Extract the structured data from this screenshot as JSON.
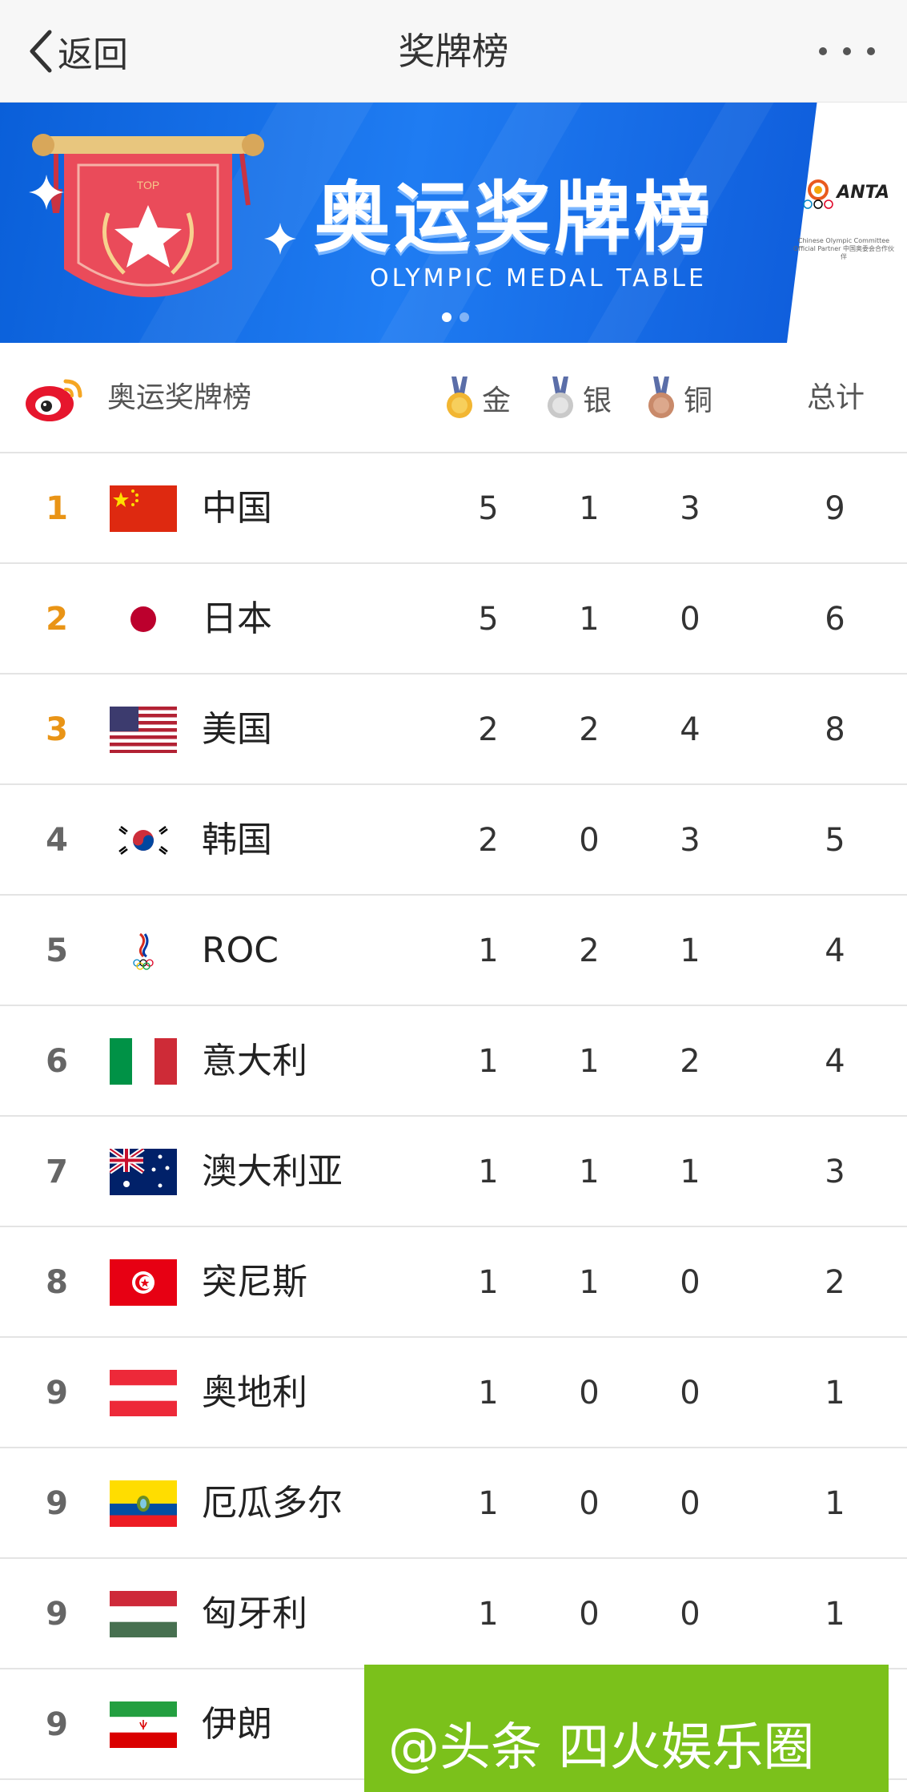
{
  "nav": {
    "back_label": "返回",
    "title": "奖牌榜"
  },
  "banner": {
    "title": "奥运奖牌榜",
    "subtitle": "OLYMPIC  MEDAL TABLE",
    "pennant_text": "TOP",
    "sponsor_brand": "ANTA",
    "sponsor_caption": "Chinese Olympic Committee Official Partner 中国奥委会合作伙伴"
  },
  "table": {
    "header": {
      "source": "奥运奖牌榜",
      "gold": "金",
      "silver": "银",
      "bronze": "铜",
      "total": "总计"
    },
    "rows": [
      {
        "rank": "1",
        "country": "中国",
        "flag": "china-flag",
        "gold": "5",
        "silver": "1",
        "bronze": "3",
        "total": "9"
      },
      {
        "rank": "2",
        "country": "日本",
        "flag": "japan-flag",
        "gold": "5",
        "silver": "1",
        "bronze": "0",
        "total": "6"
      },
      {
        "rank": "3",
        "country": "美国",
        "flag": "usa-flag",
        "gold": "2",
        "silver": "2",
        "bronze": "4",
        "total": "8"
      },
      {
        "rank": "4",
        "country": "韩国",
        "flag": "korea-flag",
        "gold": "2",
        "silver": "0",
        "bronze": "3",
        "total": "5"
      },
      {
        "rank": "5",
        "country": "ROC",
        "flag": "roc-emblem",
        "gold": "1",
        "silver": "2",
        "bronze": "1",
        "total": "4"
      },
      {
        "rank": "6",
        "country": "意大利",
        "flag": "italy-flag",
        "gold": "1",
        "silver": "1",
        "bronze": "2",
        "total": "4"
      },
      {
        "rank": "7",
        "country": "澳大利亚",
        "flag": "australia-flag",
        "gold": "1",
        "silver": "1",
        "bronze": "1",
        "total": "3"
      },
      {
        "rank": "8",
        "country": "突尼斯",
        "flag": "tunisia-flag",
        "gold": "1",
        "silver": "1",
        "bronze": "0",
        "total": "2"
      },
      {
        "rank": "9",
        "country": "奥地利",
        "flag": "austria-flag",
        "gold": "1",
        "silver": "0",
        "bronze": "0",
        "total": "1"
      },
      {
        "rank": "9",
        "country": "厄瓜多尔",
        "flag": "ecuador-flag",
        "gold": "1",
        "silver": "0",
        "bronze": "0",
        "total": "1"
      },
      {
        "rank": "9",
        "country": "匈牙利",
        "flag": "hungary-flag",
        "gold": "1",
        "silver": "0",
        "bronze": "0",
        "total": "1"
      },
      {
        "rank": "9",
        "country": "伊朗",
        "flag": "iran-flag",
        "gold": "",
        "silver": "",
        "bronze": "",
        "total": ""
      }
    ]
  },
  "watermark": {
    "text": "@头条 四火娱乐圈"
  },
  "colors": {
    "rank_top": "#e99416",
    "banner_blue": "#1f7cf2",
    "watermark_green": "#7bc11b"
  }
}
